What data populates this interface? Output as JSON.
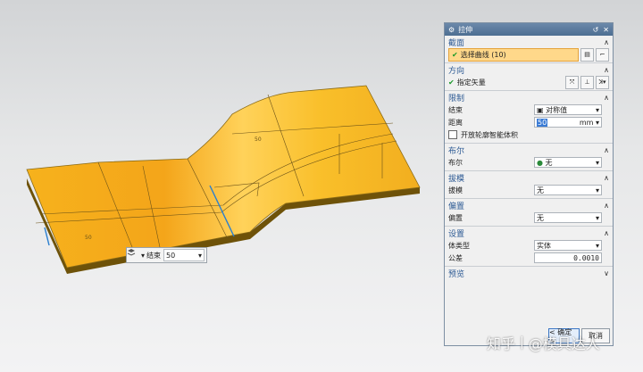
{
  "viewport": {
    "dims": {
      "length_left": "50",
      "length_top": "50"
    },
    "onscreen_input": {
      "label": "结束",
      "value": "50"
    }
  },
  "dialog": {
    "title": "拉伸",
    "sections": {
      "section_curves": {
        "title": "截面",
        "select_curve": "选择曲线 (10)"
      },
      "direction": {
        "title": "方向",
        "vector": "指定矢量"
      },
      "limits": {
        "title": "限制",
        "end_label": "结束",
        "end_value": "对称值",
        "distance_label": "距离",
        "distance_value": "50",
        "distance_unit": "mm",
        "open_profile": "开放轮廓智能体积"
      },
      "boolean": {
        "title": "布尔",
        "label": "布尔",
        "value": "无"
      },
      "draft": {
        "title": "拔模",
        "label": "拔模",
        "value": "无"
      },
      "offset": {
        "title": "偏置",
        "label": "偏置",
        "value": "无"
      },
      "settings": {
        "title": "设置",
        "body_type_label": "体类型",
        "body_type_value": "实体",
        "tolerance_label": "公差",
        "tolerance_value": "0.0010"
      },
      "preview": {
        "title": "预览"
      }
    },
    "buttons": {
      "ok": "< 确定 >",
      "cancel": "取消"
    }
  },
  "watermark": {
    "site": "知乎",
    "author": "@模具达人"
  },
  "colors": {
    "surface": "#f5b323",
    "edge": "#7a5a10",
    "accent": "#2d5a94"
  }
}
